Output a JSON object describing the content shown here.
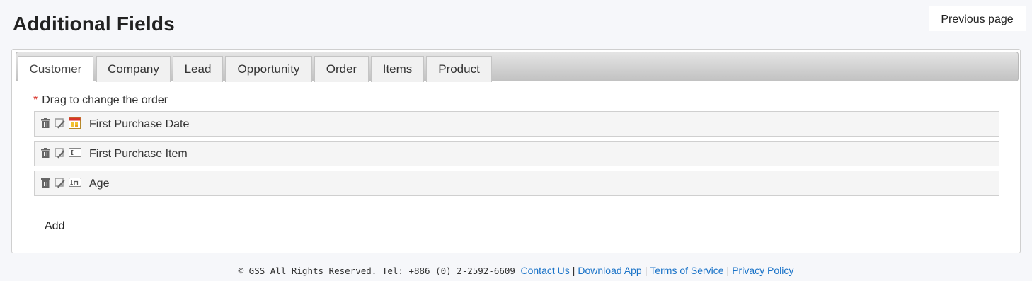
{
  "header": {
    "title": "Additional Fields",
    "previous_page_label": "Previous page"
  },
  "tabs": [
    {
      "label": "Customer",
      "active": true
    },
    {
      "label": "Company",
      "active": false
    },
    {
      "label": "Lead",
      "active": false
    },
    {
      "label": "Opportunity",
      "active": false
    },
    {
      "label": "Order",
      "active": false
    },
    {
      "label": "Items",
      "active": false
    },
    {
      "label": "Product",
      "active": false
    }
  ],
  "hint": {
    "required_mark": "*",
    "text": "Drag to change the order"
  },
  "fields": [
    {
      "label": "First Purchase Date",
      "type_icon": "calendar-icon"
    },
    {
      "label": "First Purchase Item",
      "type_icon": "text-field-icon"
    },
    {
      "label": "Age",
      "type_icon": "integer-field-icon"
    }
  ],
  "row_icons": {
    "delete": "trash-icon",
    "edit": "edit-pencil-icon"
  },
  "add_label": "Add",
  "footer": {
    "copyright": "© GSS All Rights Reserved. Tel: +886 (0) 2-2592-6609",
    "separator": "|",
    "links": [
      "Contact Us",
      "Download App",
      "Terms of Service",
      "Privacy Policy"
    ]
  },
  "colors": {
    "link": "#1a73c8",
    "required": "#d9342b",
    "page_background": "#f6f7fa"
  }
}
